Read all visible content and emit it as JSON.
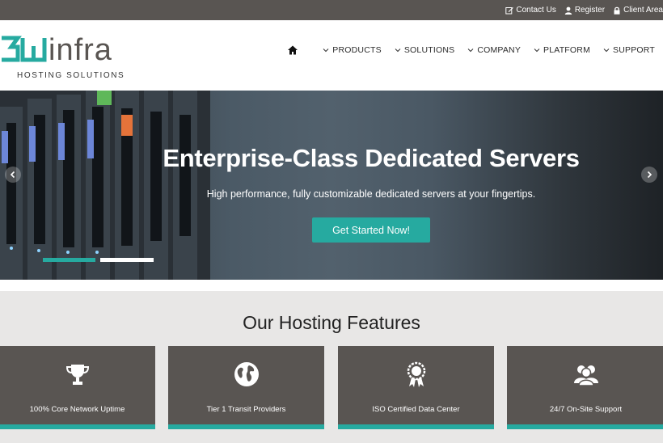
{
  "topbar": {
    "links": [
      {
        "label": "Contact Us",
        "icon": "edit-icon"
      },
      {
        "label": "Register",
        "icon": "user-icon"
      },
      {
        "label": "Client Area",
        "icon": "lock-icon"
      }
    ]
  },
  "header": {
    "logo_text": "3Winfra",
    "logo_tagline": "HOSTING SOLUTIONS",
    "nav": {
      "home_icon": "home-icon",
      "items": [
        "PRODUCTS",
        "SOLUTIONS",
        "COMPANY",
        "PLATFORM",
        "SUPPORT"
      ]
    }
  },
  "hero": {
    "title": "Enterprise-Class Dedicated Servers",
    "subtitle": "High performance, fully customizable dedicated servers at your fingertips.",
    "cta_label": "Get Started Now!",
    "active_slide": 1,
    "slide_count": 2
  },
  "features": {
    "title": "Our Hosting Features",
    "cards": [
      {
        "label": "100% Core Network Uptime",
        "icon": "trophy-icon"
      },
      {
        "label": "Tier 1 Transit Providers",
        "icon": "globe-icon"
      },
      {
        "label": "ISO Certified Data Center",
        "icon": "award-ribbon-icon"
      },
      {
        "label": "24/7 On-Site Support",
        "icon": "users-icon"
      }
    ]
  },
  "colors": {
    "accent": "#26aaa0",
    "dark": "#595552",
    "section_bg": "#e8e7e6"
  }
}
